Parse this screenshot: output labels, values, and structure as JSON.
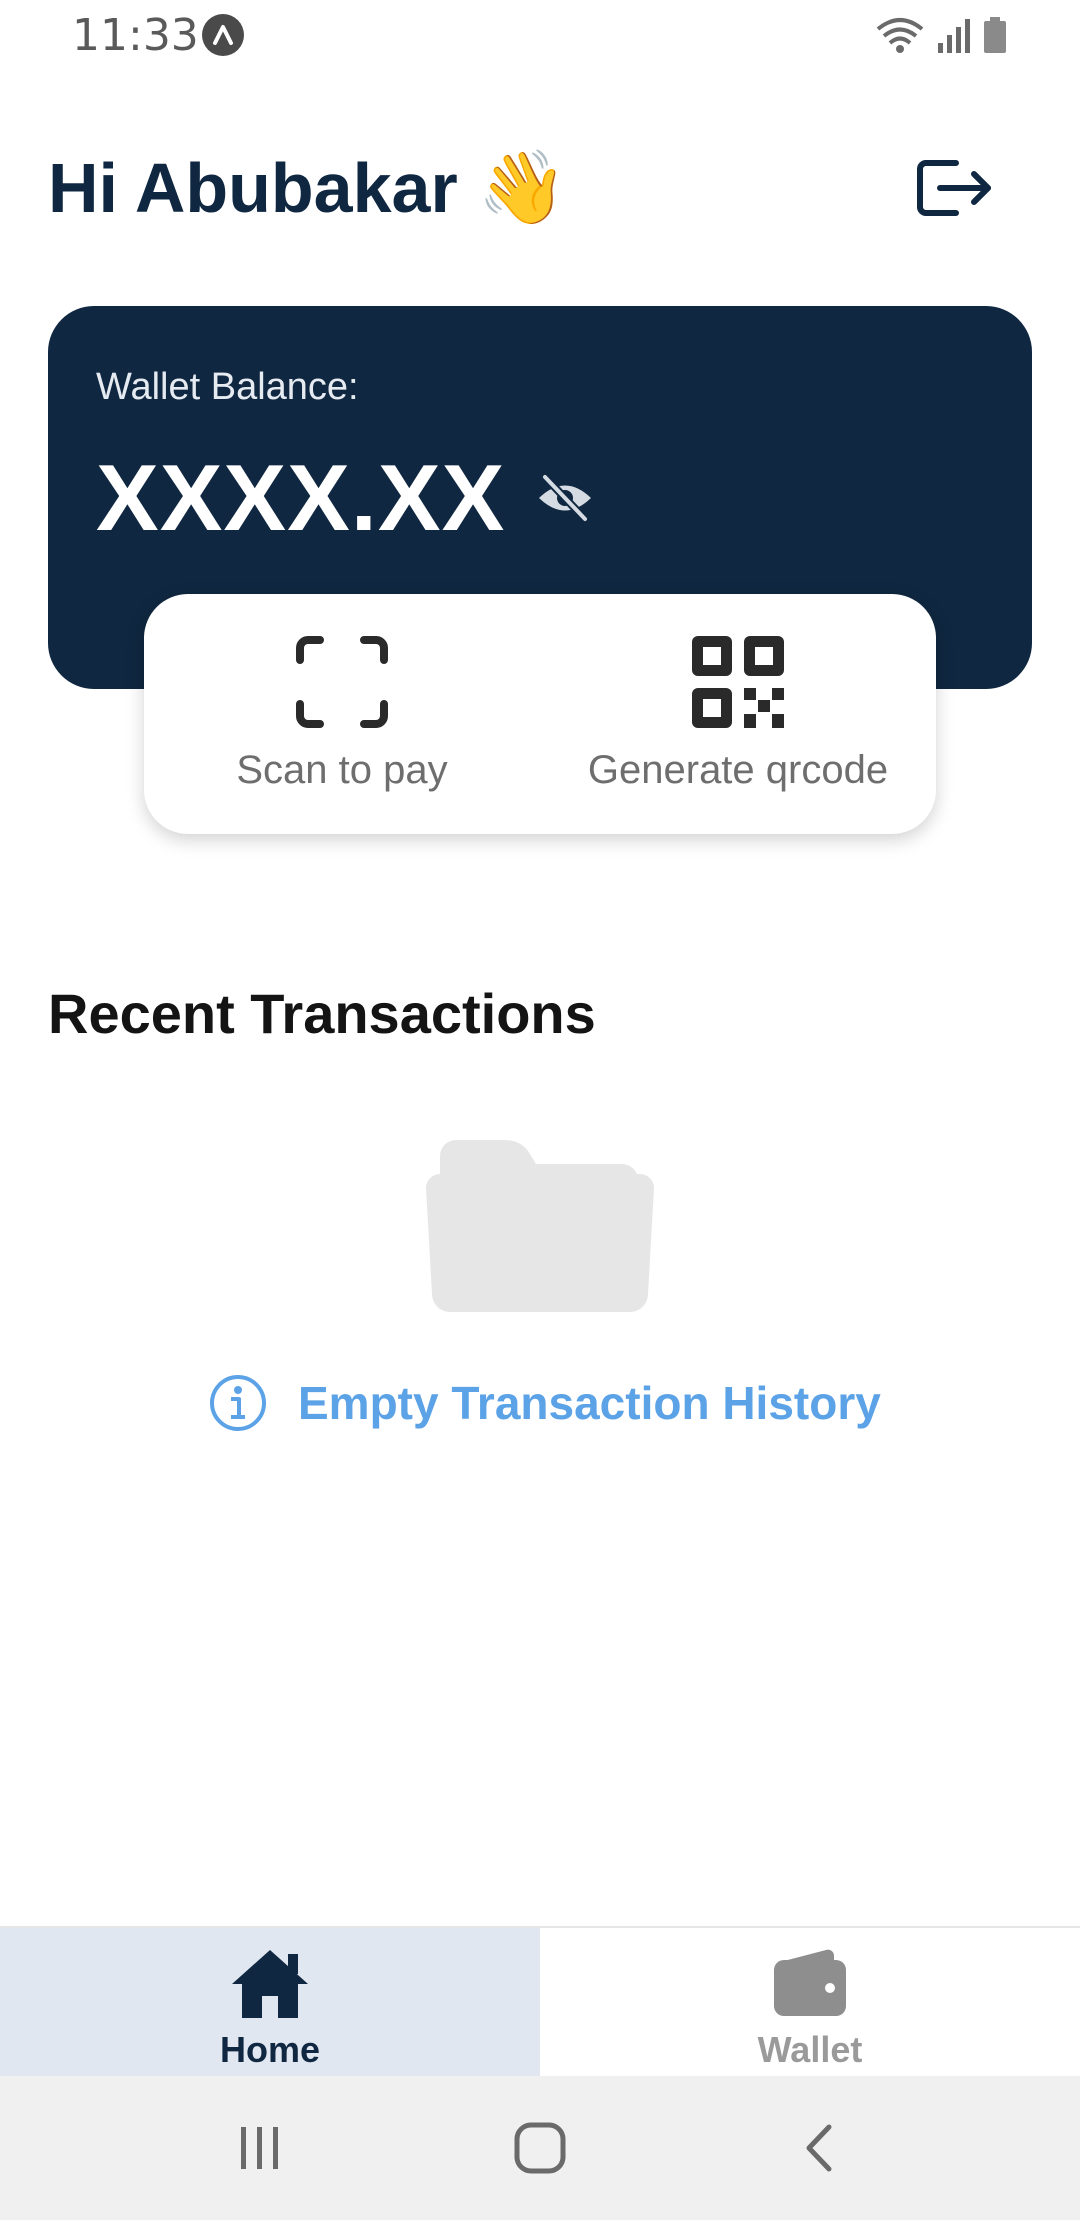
{
  "status_bar": {
    "time": "11:33",
    "app_indicator_icon": "expo-icon",
    "icons": [
      "wifi-icon",
      "signal-icon",
      "battery-icon"
    ]
  },
  "header": {
    "greeting": "Hi Abubakar",
    "greeting_emoji": "👋",
    "logout_icon": "logout-icon"
  },
  "wallet": {
    "label": "Wallet Balance:",
    "balance": "XXXX.XX",
    "visibility_icon": "eye-off-icon",
    "card_color": "#0f2740"
  },
  "actions": [
    {
      "label": "Scan to pay",
      "icon": "scan-icon"
    },
    {
      "label": "Generate qrcode",
      "icon": "qrcode-icon"
    }
  ],
  "transactions": {
    "title": "Recent Transactions",
    "empty_icon": "folder-icon",
    "empty_info_icon": "info-icon",
    "empty_message": "Empty Transaction History",
    "empty_color": "#5ba2e6"
  },
  "bottom_nav": {
    "tabs": [
      {
        "label": "Home",
        "icon": "home-icon",
        "active": true
      },
      {
        "label": "Wallet",
        "icon": "wallet-icon",
        "active": false
      }
    ]
  },
  "system_nav": [
    "recent-apps-icon",
    "home-circle-icon",
    "back-icon"
  ]
}
